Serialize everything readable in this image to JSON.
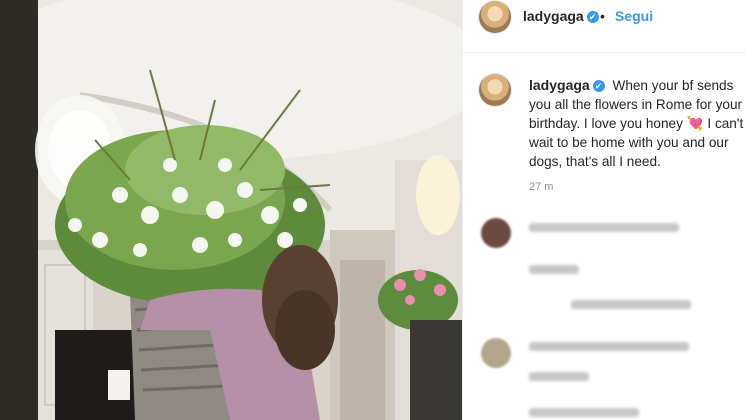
{
  "post": {
    "username": "ladygaga",
    "follow_label": "Segui",
    "dot": "•",
    "verified_mark": "✔",
    "caption": "When your bf sends you all the flowers in Rome for your birthday. I love you honey 💘 I can't wait to be home with you and our dogs, that's all I need.",
    "time": "27 m"
  },
  "colors": {
    "accent": "#3897f0",
    "text": "#262626",
    "muted": "#8e8e8e"
  },
  "icons": [
    "verified-badge-icon"
  ]
}
